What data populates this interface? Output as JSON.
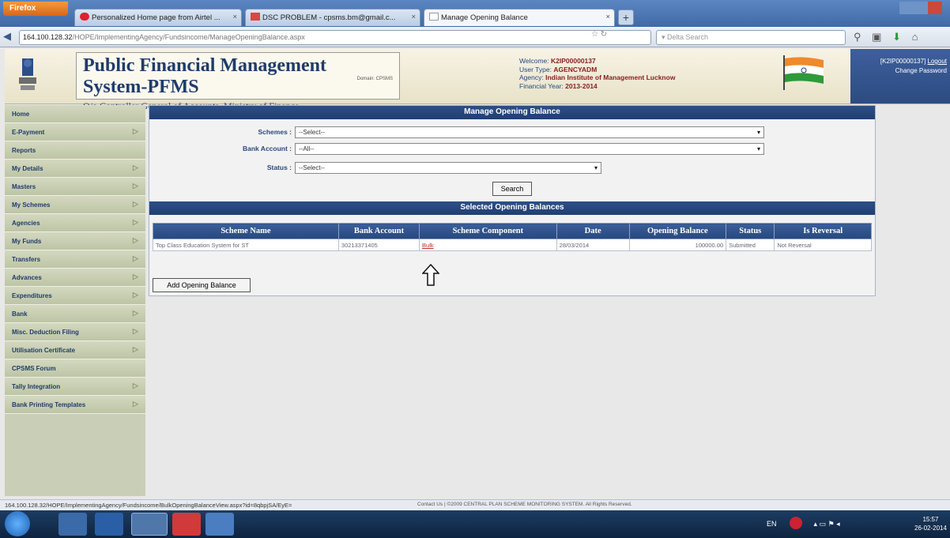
{
  "browser": {
    "app_button": "Firefox",
    "tabs": [
      {
        "label": "Personalized Home page from Airtel ..."
      },
      {
        "label": "DSC PROBLEM - cpsms.bm@gmail.c..."
      },
      {
        "label": "Manage Opening Balance"
      }
    ],
    "new_tab": "+",
    "url_host": "164.100.128.32",
    "url_path": "/HOPE/ImplementingAgency/Fundsincome/ManageOpeningBalance.aspx",
    "search_placeholder": "Delta Search"
  },
  "header": {
    "title": "Public Financial Management System-PFMS",
    "subtitle": "O/o Controller General of Accounts, Ministry of Finance",
    "domain": "Domain: CPSMS",
    "welcome_label": "Welcome:",
    "welcome_value": "K2IP00000137",
    "user_type_label": "User Type:",
    "user_type_value": "AGENCYADM",
    "agency_label": "Agency:",
    "agency_value": "Indian Institute of Management Lucknow",
    "fy_label": "Financial Year:",
    "fy_value": "2013-2014",
    "login_id": "[K2IP00000137]",
    "logout": "Logout",
    "change_password": "Change Password"
  },
  "sidebar": {
    "items": [
      {
        "label": "Home",
        "has_submenu": false
      },
      {
        "label": "E-Payment",
        "has_submenu": true
      },
      {
        "label": "Reports",
        "has_submenu": false
      },
      {
        "label": "My Details",
        "has_submenu": true
      },
      {
        "label": "Masters",
        "has_submenu": true
      },
      {
        "label": "My Schemes",
        "has_submenu": true
      },
      {
        "label": "Agencies",
        "has_submenu": true
      },
      {
        "label": "My Funds",
        "has_submenu": true
      },
      {
        "label": "Transfers",
        "has_submenu": true
      },
      {
        "label": "Advances",
        "has_submenu": true
      },
      {
        "label": "Expenditures",
        "has_submenu": true
      },
      {
        "label": "Bank",
        "has_submenu": true
      },
      {
        "label": "Misc. Deduction Filing",
        "has_submenu": true
      },
      {
        "label": "Utilisation Certificate",
        "has_submenu": true
      },
      {
        "label": "CPSMS Forum",
        "has_submenu": false
      },
      {
        "label": "Tally Integration",
        "has_submenu": true
      },
      {
        "label": "Bank Printing Templates",
        "has_submenu": true
      }
    ]
  },
  "form": {
    "panel_title": "Manage Opening Balance",
    "schemes_label": "Schemes :",
    "schemes_value": "--Select--",
    "bank_account_label": "Bank Account :",
    "bank_account_value": "--All--",
    "status_label": "Status :",
    "status_value": "--Select--",
    "search_button": "Search"
  },
  "results": {
    "panel_title": "Selected Opening Balances",
    "columns": [
      "Scheme Name",
      "Bank Account",
      "Scheme Component",
      "Date",
      "Opening Balance",
      "Status",
      "Is Reversal"
    ],
    "rows": [
      [
        "Top Class Education System for ST",
        "30213371405",
        "Bulk",
        "28/03/2014",
        "100000.00",
        "Submitted",
        "Not Reversal"
      ]
    ],
    "add_button": "Add Opening Balance"
  },
  "status_bar": {
    "url": "164.100.128.32/HOPE/ImplementingAgency/Fundsincome/BulkOpeningBalanceView.aspx?id=8qbpjSA/EyE=",
    "footer": "Contact Us | ©2009 CENTRAL PLAN SCHEME MONITORING SYSTEM. All Rights Reserved."
  },
  "taskbar": {
    "lang": "EN",
    "time": "15:57",
    "date": "26-02-2014"
  }
}
